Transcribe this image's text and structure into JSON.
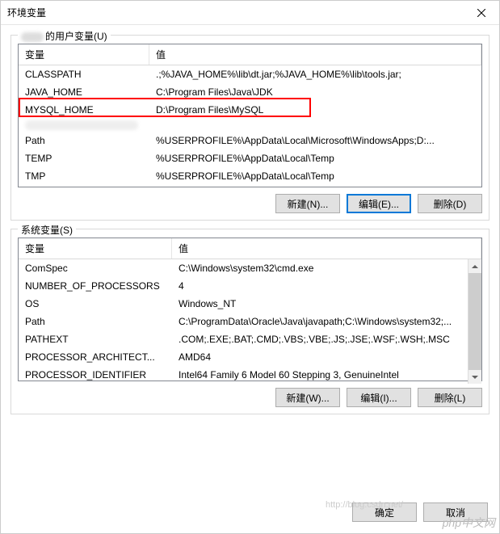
{
  "titlebar": {
    "title": "环境变量"
  },
  "user_section": {
    "label_suffix": "的用户变量(U)",
    "columns": {
      "name": "变量",
      "value": "值"
    },
    "rows": [
      {
        "name": "CLASSPATH",
        "value": ".;%JAVA_HOME%\\lib\\dt.jar;%JAVA_HOME%\\lib\\tools.jar;"
      },
      {
        "name": "JAVA_HOME",
        "value": "C:\\Program Files\\Java\\JDK"
      },
      {
        "name": "MYSQL_HOME",
        "value": "D:\\Program Files\\MySQL"
      },
      {
        "name": "Path",
        "value": "%USERPROFILE%\\AppData\\Local\\Microsoft\\WindowsApps;D:..."
      },
      {
        "name": "TEMP",
        "value": "%USERPROFILE%\\AppData\\Local\\Temp"
      },
      {
        "name": "TMP",
        "value": "%USERPROFILE%\\AppData\\Local\\Temp"
      }
    ],
    "buttons": {
      "new": "新建(N)...",
      "edit": "编辑(E)...",
      "delete": "删除(D)"
    }
  },
  "system_section": {
    "label": "系统变量(S)",
    "columns": {
      "name": "变量",
      "value": "值"
    },
    "rows": [
      {
        "name": "ComSpec",
        "value": "C:\\Windows\\system32\\cmd.exe"
      },
      {
        "name": "NUMBER_OF_PROCESSORS",
        "value": "4"
      },
      {
        "name": "OS",
        "value": "Windows_NT"
      },
      {
        "name": "Path",
        "value": "C:\\ProgramData\\Oracle\\Java\\javapath;C:\\Windows\\system32;..."
      },
      {
        "name": "PATHEXT",
        "value": ".COM;.EXE;.BAT;.CMD;.VBS;.VBE;.JS;.JSE;.WSF;.WSH;.MSC"
      },
      {
        "name": "PROCESSOR_ARCHITECT...",
        "value": "AMD64"
      },
      {
        "name": "PROCESSOR_IDENTIFIER",
        "value": "Intel64 Family 6 Model 60 Stepping 3, GenuineIntel"
      }
    ],
    "buttons": {
      "new": "新建(W)...",
      "edit": "编辑(I)...",
      "delete": "删除(L)"
    }
  },
  "footer": {
    "ok": "确定",
    "cancel": "取消"
  },
  "watermark": "http://blog.csdn.net/",
  "logo": "php中文网"
}
